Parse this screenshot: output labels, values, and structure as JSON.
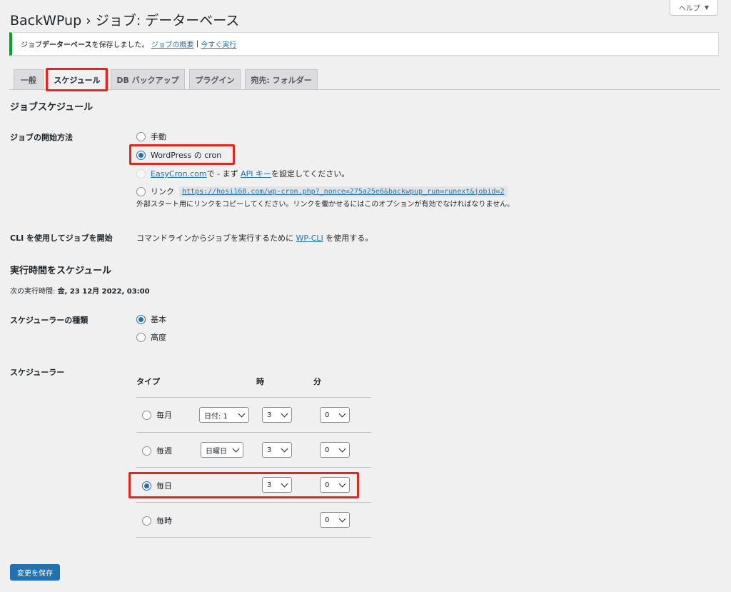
{
  "header": {
    "title": "BackWPup › ジョブ: データーベース",
    "help_label": "ヘルプ"
  },
  "notice": {
    "prefix": "ジョブ ",
    "job_name": "データーベース",
    "suffix": " を保存しました。",
    "link_overview": "ジョブの概要",
    "separator": " | ",
    "link_run_now": "今すぐ実行"
  },
  "tabs": [
    {
      "label": "一般"
    },
    {
      "label": "スケジュール"
    },
    {
      "label": "DB バックアップ"
    },
    {
      "label": "プラグイン"
    },
    {
      "label": "宛先: フォルダー"
    }
  ],
  "job_schedule": {
    "heading": "ジョブスケジュール",
    "start_label": "ジョブの開始方法",
    "options": {
      "manual": "手動",
      "wp_cron": "WordPress の cron",
      "easycron_link": "EasyCron.com",
      "easycron_mid": "で - まず ",
      "easycron_api_link": "API キー",
      "easycron_suffix": "を設定してください。",
      "link": "リンク",
      "link_url": "https://hosi168.com/wp-cron.php?_nonce=275a25e6&backwpup_run=runext&jobid=2",
      "link_help": "外部スタート用にリンクをコピーしてください。リンクを働かせるにはこのオプションが有効でなければなりません。"
    },
    "cli_label": "CLI を使用してジョブを開始",
    "cli_text_prefix": "コマンドラインからジョブを実行するために ",
    "cli_link": "WP-CLI",
    "cli_text_suffix": " を使用する。"
  },
  "run_schedule": {
    "heading": "実行時間をスケジュール",
    "next_run_label": "次の実行時間: ",
    "next_run_value": "金, 23 12月 2022, 03:00",
    "type_label": "スケジューラーの種類",
    "type_basic": "基本",
    "type_advanced": "高度",
    "scheduler_label": "スケジューラー",
    "columns": {
      "type": "タイプ",
      "hour": "時",
      "minute": "分"
    },
    "rows": [
      {
        "label": "毎月",
        "day": "日付: 1",
        "hour": "3",
        "minute": "0"
      },
      {
        "label": "毎週",
        "day": "日曜日",
        "hour": "3",
        "minute": "0"
      },
      {
        "label": "毎日",
        "hour": "3",
        "minute": "0"
      },
      {
        "label": "毎時",
        "minute": "0"
      }
    ]
  },
  "save_button": "変更を保存",
  "colors": {
    "accent": "#2271b1",
    "highlight": "#e2261c",
    "success": "#00a32a"
  }
}
